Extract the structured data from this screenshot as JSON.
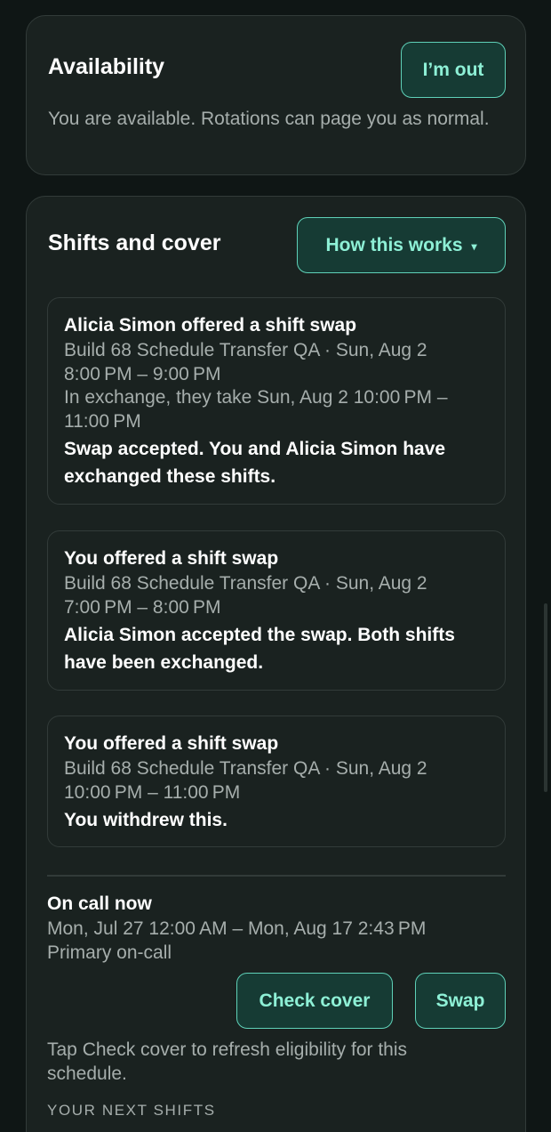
{
  "availability": {
    "title": "Availability",
    "button_label": "I’m out",
    "description": "You are available. Rotations can page you as normal."
  },
  "shifts": {
    "title": "Shifts and cover",
    "how_button_label": "How this works",
    "how_button_caret": "▾",
    "items": [
      {
        "heading": "Alicia Simon offered a shift swap",
        "lines": [
          "Build 68 Schedule Transfer QA · Sun, Aug 2",
          "8:00 PM – 9:00 PM",
          "In exchange, they take Sun, Aug 2 10:00 PM –",
          "11:00 PM"
        ],
        "status": "Swap accepted. You and Alicia Simon have exchanged these shifts."
      },
      {
        "heading": "You offered a shift swap",
        "lines": [
          "Build 68 Schedule Transfer QA · Sun, Aug 2",
          "7:00 PM – 8:00 PM"
        ],
        "status": "Alicia Simon accepted the swap. Both shifts have been exchanged."
      },
      {
        "heading": "You offered a shift swap",
        "lines": [
          "Build 68 Schedule Transfer QA · Sun, Aug 2",
          "10:00 PM – 11:00 PM"
        ],
        "status": "You withdrew this."
      }
    ],
    "on_call": {
      "title": "On call now",
      "range": "Mon, Jul 27 12:00 AM – Mon, Aug 17 2:43 PM",
      "role": "Primary on-call"
    },
    "check_cover_label": "Check cover",
    "swap_label": "Swap",
    "hint": "Tap Check cover to refresh eligibility for this schedule.",
    "next_shifts_label": "YOUR NEXT SHIFTS"
  },
  "colors": {
    "background": "#0f1615",
    "card": "#1a2220",
    "accent": "#8ef0d6",
    "accent_border": "#5fd1b8",
    "button_fill": "#163b34",
    "muted_text": "#a6aeac"
  }
}
